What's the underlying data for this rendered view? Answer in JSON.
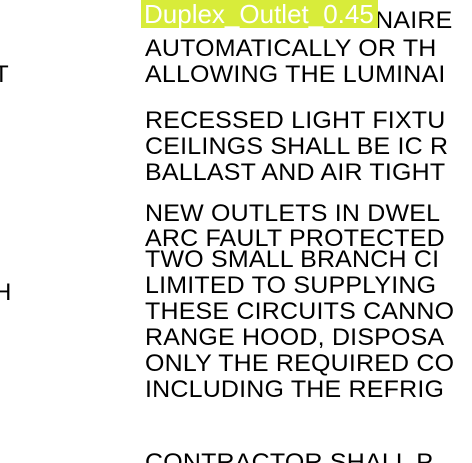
{
  "overlay": {
    "label": "Duplex_Outlet_0.45"
  },
  "left_fragments": [
    "T",
    "H"
  ],
  "notes": [
    [
      "ALLOWS THE LUMINAIRE",
      "AUTOMATICALLY OR TH",
      "ALLOWING THE LUMINAI"
    ],
    [
      "RECESSED LIGHT FIXTU",
      "CEILINGS SHALL BE IC R",
      "BALLAST AND AIR TIGHT"
    ],
    [
      "NEW OUTLETS IN DWEL",
      "ARC FAULT PROTECTED"
    ],
    [
      "TWO SMALL BRANCH CI",
      "LIMITED TO SUPPLYING",
      "THESE CIRCUITS CANNO",
      "RANGE HOOD, DISPOSA",
      "ONLY THE REQUIRED CO",
      "INCLUDING THE REFRIG"
    ],
    [
      "CONTRACTOR SHALL P"
    ]
  ]
}
